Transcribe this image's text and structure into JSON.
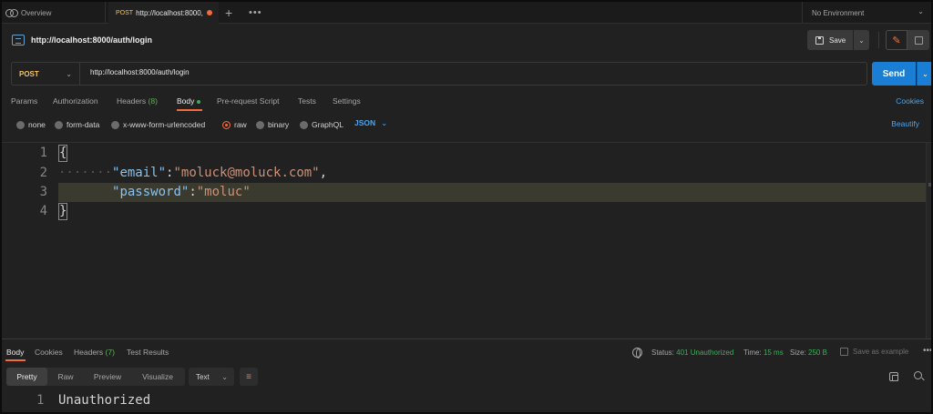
{
  "tabs": {
    "overview": "Overview",
    "active": {
      "method": "POST",
      "label": "http://localhost:8000,"
    },
    "new_tab": "+",
    "more": "•••",
    "environment": "No Environment"
  },
  "request": {
    "title": "http://localhost:8000/auth/login",
    "save_label": "Save",
    "method": "POST",
    "url": "http://localhost:8000/auth/login",
    "send_label": "Send"
  },
  "request_tabs": {
    "params": "Params",
    "authorization": "Authorization",
    "headers": "Headers",
    "headers_count": "(8)",
    "body": "Body",
    "prerequest": "Pre-request Script",
    "tests": "Tests",
    "settings": "Settings",
    "cookies": "Cookies"
  },
  "body_types": {
    "none": "none",
    "form_data": "form-data",
    "urlencoded": "x-www-form-urlencoded",
    "raw": "raw",
    "binary": "binary",
    "graphql": "GraphQL",
    "selected_format": "JSON",
    "beautify": "Beautify"
  },
  "editor": {
    "line_numbers": [
      "1",
      "2",
      "3",
      "4"
    ],
    "open_brace": "{",
    "close_brace": "}",
    "line2_ws": "·······",
    "email_key": "\"email\"",
    "email_value": "\"moluck@moluck.com\"",
    "password_key": "\"password\"",
    "password_value": "\"moluc\"",
    "colon": ":",
    "comma": ","
  },
  "response": {
    "tabs": {
      "body": "Body",
      "cookies": "Cookies",
      "headers": "Headers",
      "headers_count": "(7)",
      "test_results": "Test Results"
    },
    "status_label": "Status:",
    "status_value": "401 Unauthorized",
    "time_label": "Time:",
    "time_value": "15 ms",
    "size_label": "Size:",
    "size_value": "250 B",
    "save_example": "Save as example",
    "more": "•••",
    "formats": {
      "pretty": "Pretty",
      "raw": "Raw",
      "preview": "Preview",
      "visualize": "Visualize"
    },
    "text_type": "Text",
    "line_number": "1",
    "content": "Unauthorized"
  },
  "colors": {
    "accent_orange": "#f26b3a",
    "send_blue": "#1a7fd4",
    "link_blue": "#4fa3ea",
    "status_green": "#3fae5b",
    "method_yellow": "#f5c25b"
  }
}
